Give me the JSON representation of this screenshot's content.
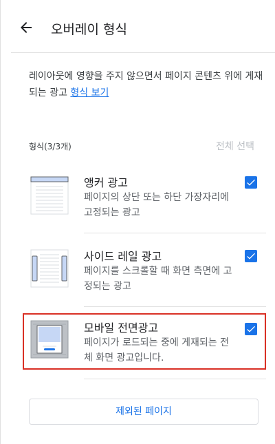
{
  "header": {
    "title": "오버레이 형식",
    "back_icon": "arrow-left-icon"
  },
  "description": {
    "text": "레이아웃에 영향을 주지 않으면서 페이지 콘텐츠 위에 게재되는 광고 ",
    "link": "형식 보기"
  },
  "formats": {
    "count_label": "형식(3/3개)",
    "select_all_label": "전체 선택",
    "items": [
      {
        "title": "앵커 광고",
        "description": "페이지의 상단 또는 하단 가장자리에 고정되는 광고",
        "checked": true
      },
      {
        "title": "사이드 레일 광고",
        "description": "페이지를 스크롤할 때 화면 측면에 고정되는 광고",
        "checked": true
      },
      {
        "title": "모바일 전면광고",
        "description": "페이지가 로드되는 중에 게재되는 전체 화면 광고입니다.",
        "checked": true
      }
    ]
  },
  "excluded_pages_button": "제외된 페이지",
  "colors": {
    "accent": "#1a73e8",
    "highlight": "#d93025"
  }
}
